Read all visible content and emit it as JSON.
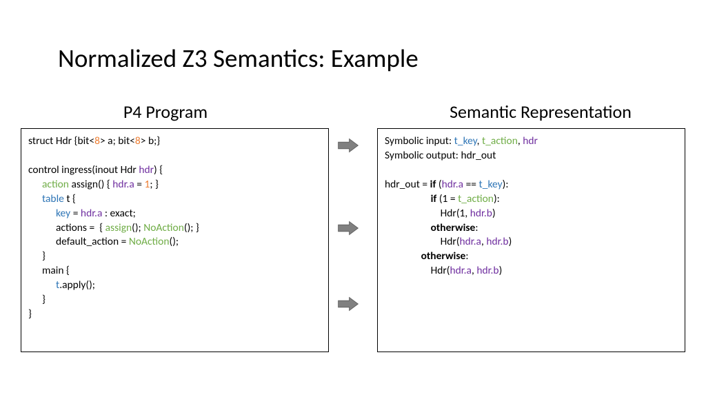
{
  "title": "Normalized Z3 Semantics: Example",
  "left_heading": "P4 Program",
  "right_heading": "Semantic Representation",
  "p4": {
    "struct_pre": "struct Hdr {bit<",
    "eight": "8",
    "struct_mid": "> a; bit<",
    "struct_end": "> b;}",
    "ctrl_pre": "control ingress(inout Hdr ",
    "hdr": "hdr",
    "ctrl_post": ") {",
    "action_kw": "action",
    "assign_text": " assign() { ",
    "hdr_a": "hdr.a",
    "eq": " = ",
    "one": "1",
    "assign_end": "; }",
    "table_kw": "table",
    "t_name": " t {",
    "key_kw": "key",
    "key_rest": " = ",
    "key_exact": " : exact;",
    "actions_line_pre": "actions =  { ",
    "assign_fn": "assign",
    "noaction": "NoAction",
    "actions_line_mid": "(); ",
    "actions_line_end": "(); }",
    "default_pre": "default_action = ",
    "default_post": "();",
    "rbrace": "}",
    "main_kw": "main {",
    "t_var": "t",
    "apply": ".apply();"
  },
  "sem": {
    "sym_in_pre": "Symbolic input: ",
    "t_key": "t_key",
    "comma": ", ",
    "t_action": "t_action",
    "hdr": "hdr",
    "sym_out": "Symbolic output: hdr_out",
    "hdr_out_pre": "hdr_out = ",
    "if_kw": "if",
    "lp": " (",
    "hdr_a": "hdr.a",
    "eqeq": " == ",
    "rp_colon": "):",
    "one_eq": " (1 = ",
    "hdr_ctor_pre": "Hdr(",
    "one": "1",
    "hdr_b": "hdr.b",
    "rp": ")",
    "otherwise": "otherwise",
    "colon": ":"
  }
}
